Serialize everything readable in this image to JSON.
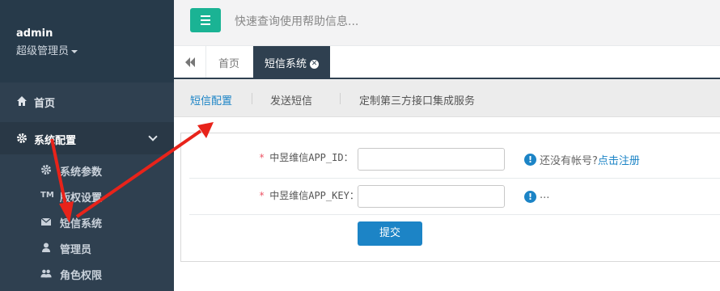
{
  "sidebar": {
    "user": {
      "name": "admin",
      "role": "超级管理员"
    },
    "nav": [
      {
        "label": "首页",
        "icon": "home-icon"
      },
      {
        "label": "系统配置",
        "icon": "gear-icon"
      }
    ],
    "sub": [
      {
        "label": "系统参数",
        "icon": "gear-icon"
      },
      {
        "label": "版权设置",
        "icon": "trademark-icon"
      },
      {
        "label": "短信系统",
        "icon": "envelope-icon"
      },
      {
        "label": "管理员",
        "icon": "user-icon"
      },
      {
        "label": "角色权限",
        "icon": "users-icon"
      }
    ]
  },
  "topbar": {
    "search_placeholder": "快速查询使用帮助信息..."
  },
  "tabs": [
    {
      "label": "首页"
    },
    {
      "label": "短信系统",
      "closable": true
    }
  ],
  "subnav": [
    {
      "label": "短信配置"
    },
    {
      "label": "发送短信"
    },
    {
      "label": "定制第三方接口集成服务"
    }
  ],
  "form": {
    "fields": [
      {
        "required": "*",
        "label": "中昱维信APP_ID",
        "colon": "：",
        "value": "",
        "hint_prefix": "还没有帐号?",
        "hint_link": "点击注册"
      },
      {
        "required": "*",
        "label": "中昱维信APP_KEY",
        "colon": "：",
        "value": "",
        "hint_prefix": "..."
      }
    ],
    "submit_label": "提交"
  },
  "colors": {
    "sidebar": "#2f4050",
    "accent": "#1c84c6",
    "menu_button": "#1ab394",
    "annotation": "#e8231a"
  }
}
